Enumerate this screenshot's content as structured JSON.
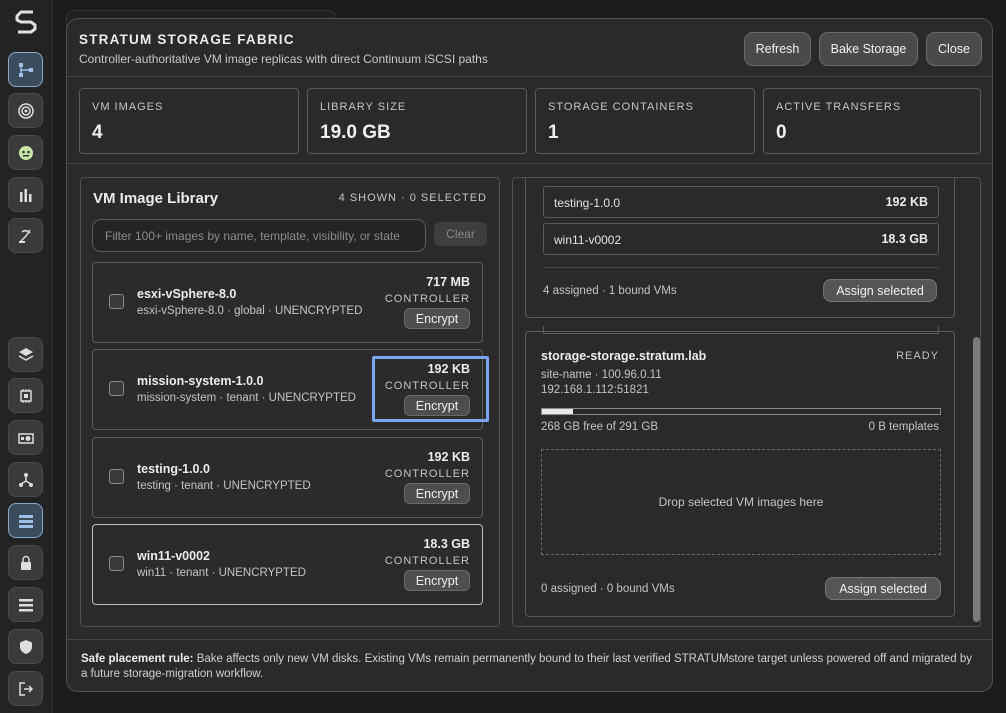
{
  "modal": {
    "title": "STRATUM STORAGE FABRIC",
    "subtitle": "Controller-authoritative VM image replicas with direct Continuum iSCSI paths",
    "buttons": {
      "refresh": "Refresh",
      "bake": "Bake Storage",
      "close": "Close"
    }
  },
  "stats": [
    {
      "label": "VM IMAGES",
      "value": "4"
    },
    {
      "label": "LIBRARY SIZE",
      "value": "19.0 GB"
    },
    {
      "label": "STORAGE CONTAINERS",
      "value": "1"
    },
    {
      "label": "ACTIVE TRANSFERS",
      "value": "0"
    }
  ],
  "library": {
    "title": "VM Image Library",
    "count": "4 SHOWN · 0 SELECTED",
    "search_placeholder": "Filter 100+ images by name, template, visibility, or state",
    "clear_label": "Clear",
    "images": [
      {
        "name": "esxi-vSphere-8.0",
        "meta": "esxi-vSphere-8.0 · global · UNENCRYPTED",
        "size": "717 MB",
        "location": "CONTROLLER",
        "action": "Encrypt"
      },
      {
        "name": "mission-system-1.0.0",
        "meta": "mission-system · tenant · UNENCRYPTED",
        "size": "192 KB",
        "location": "CONTROLLER",
        "action": "Encrypt"
      },
      {
        "name": "testing-1.0.0",
        "meta": "testing · tenant · UNENCRYPTED",
        "size": "192 KB",
        "location": "CONTROLLER",
        "action": "Encrypt"
      },
      {
        "name": "win11-v0002",
        "meta": "win11 · tenant · UNENCRYPTED",
        "size": "18.3 GB",
        "location": "CONTROLLER",
        "action": "Encrypt"
      }
    ]
  },
  "targets": {
    "first": {
      "rows": [
        {
          "name": "testing-1.0.0",
          "size": "192 KB"
        },
        {
          "name": "win11-v0002",
          "size": "18.3 GB"
        }
      ],
      "summary": "4 assigned · 1 bound VMs",
      "assign_label": "Assign selected"
    },
    "second": {
      "name": "storage-storage.stratum.lab",
      "status": "READY",
      "site": "site-name · 100.96.0.11",
      "address": "192.168.1.112:51821",
      "usage_fraction": 0.079,
      "free": "268 GB free of 291 GB",
      "templates": "0 B templates",
      "drop_text": "Drop selected VM images here",
      "summary": "0 assigned · 0 bound VMs",
      "assign_label": "Assign selected"
    }
  },
  "footer": {
    "rule_label": "Safe placement rule:",
    "rule_text": "Bake affects only new VM disks. Existing VMs remain permanently bound to their last verified STRATUMstore target unless powered off and migrated by a future storage-migration workflow."
  },
  "colors": {
    "focus": "#7aa4ef",
    "accent": "#8aa9c6",
    "bar_fill": "#e8e8e8"
  },
  "rail_icons": [
    "topology-icon",
    "target-icon",
    "robot-icon",
    "chart-icon",
    "antenna-icon",
    "layers-icon",
    "chip-icon",
    "gpu-icon",
    "network-icon",
    "storage-icon",
    "lock-icon",
    "list-icon",
    "shield-icon",
    "logout-icon"
  ]
}
